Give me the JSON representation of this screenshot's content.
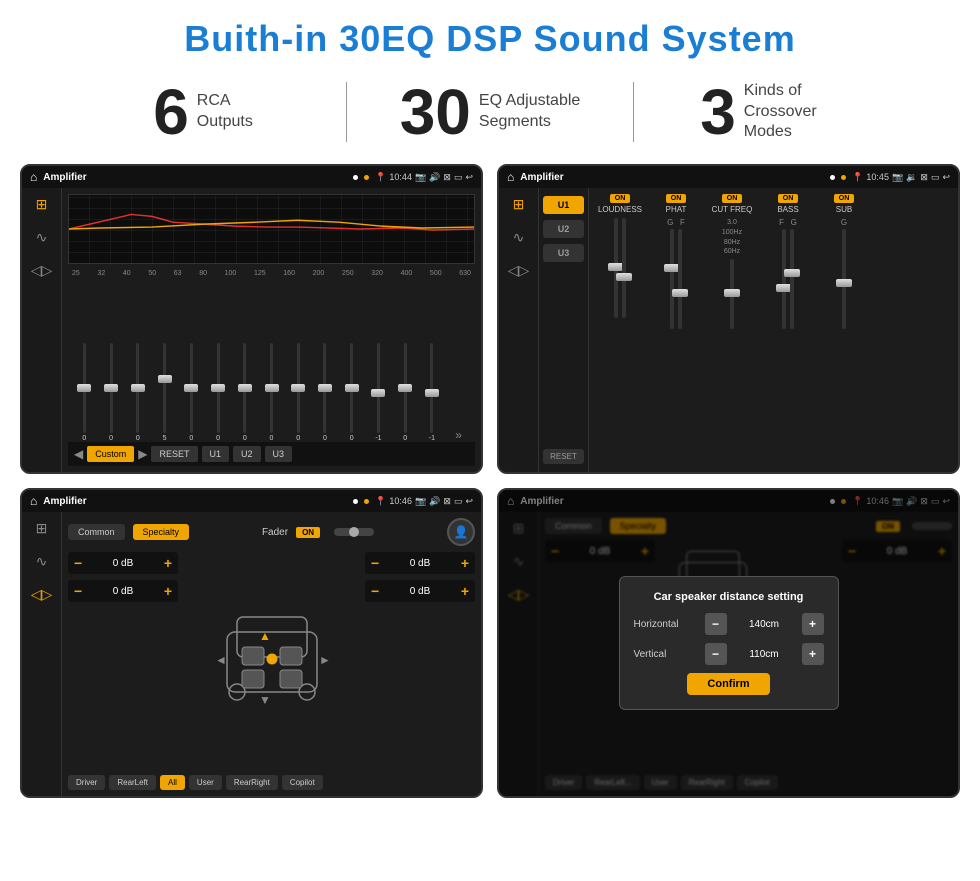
{
  "title": "Buith-in 30EQ DSP Sound System",
  "stats": [
    {
      "number": "6",
      "label": "RCA\nOutputs"
    },
    {
      "number": "30",
      "label": "EQ Adjustable\nSegments"
    },
    {
      "number": "3",
      "label": "Kinds of\nCrossover Modes"
    }
  ],
  "screens": [
    {
      "id": "eq-screen",
      "statusBar": {
        "title": "Amplifier",
        "time": "10:44"
      }
    },
    {
      "id": "crossover-screen",
      "statusBar": {
        "title": "Amplifier",
        "time": "10:45"
      }
    },
    {
      "id": "fader-screen",
      "statusBar": {
        "title": "Amplifier",
        "time": "10:46"
      }
    },
    {
      "id": "distance-screen",
      "statusBar": {
        "title": "Amplifier",
        "time": "10:46"
      },
      "dialog": {
        "title": "Car speaker distance setting",
        "horizontal": "140cm",
        "vertical": "110cm",
        "confirmLabel": "Confirm"
      }
    }
  ],
  "eq": {
    "frequencies": [
      "25",
      "32",
      "40",
      "50",
      "63",
      "80",
      "100",
      "125",
      "160",
      "200",
      "250",
      "320",
      "400",
      "500",
      "630"
    ],
    "values": [
      "0",
      "0",
      "0",
      "5",
      "0",
      "0",
      "0",
      "0",
      "0",
      "0",
      "0",
      "-1",
      "0",
      "-1"
    ],
    "presets": [
      "Custom",
      "RESET",
      "U1",
      "U2",
      "U3"
    ]
  },
  "crossover": {
    "channels": [
      "U1",
      "U2",
      "U3"
    ],
    "controls": [
      "LOUDNESS",
      "PHAT",
      "CUT FREQ",
      "BASS",
      "SUB"
    ]
  },
  "fader": {
    "tabs": [
      "Common",
      "Specialty"
    ],
    "label": "Fader",
    "seats": [
      "Driver",
      "RearLeft",
      "All",
      "User",
      "RearRight",
      "Copilot"
    ],
    "dbValues": [
      "0 dB",
      "0 dB",
      "0 dB",
      "0 dB"
    ]
  },
  "dialog": {
    "title": "Car speaker distance setting",
    "horizontal_label": "Horizontal",
    "horizontal_value": "140cm",
    "vertical_label": "Vertical",
    "vertical_value": "110cm",
    "confirm_label": "Confirm"
  }
}
